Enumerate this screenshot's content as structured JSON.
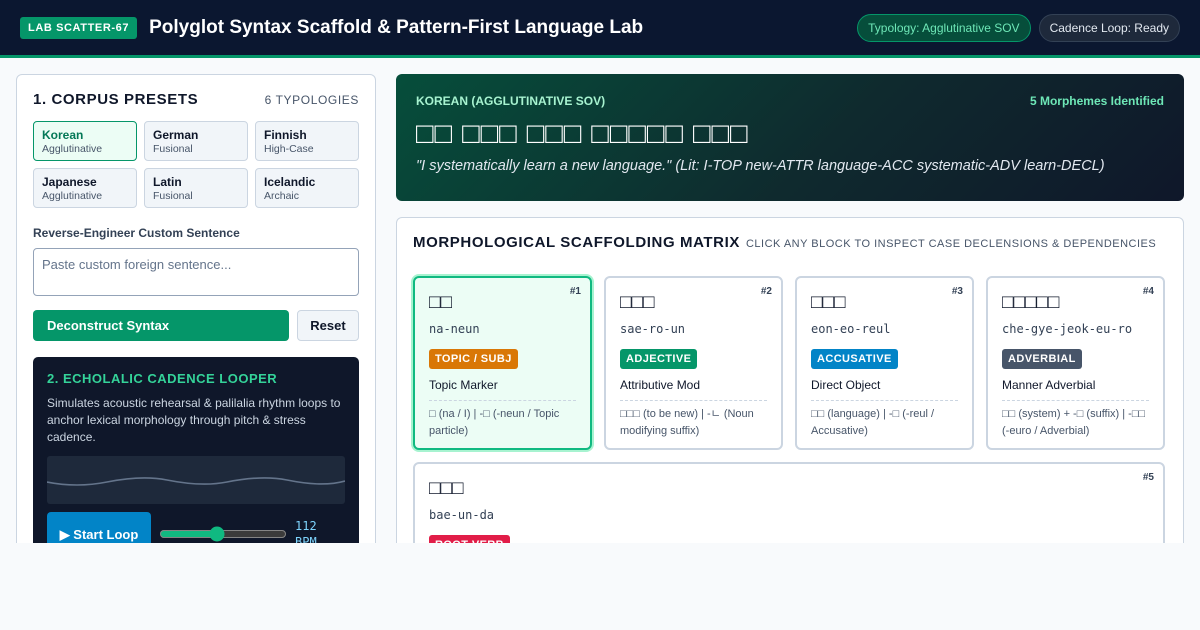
{
  "header": {
    "badge": "LAB SCATTER-67",
    "title": "Polyglot Syntax Scaffold & Pattern-First Language Lab",
    "typology_pill": "Typology: Agglutinative SOV",
    "cadence_pill": "Cadence Loop: Ready"
  },
  "presets": {
    "title": "1. CORPUS PRESETS",
    "count": "6 TYPOLOGIES",
    "items": [
      {
        "name": "Korean",
        "sub": "Agglutinative"
      },
      {
        "name": "German",
        "sub": "Fusional"
      },
      {
        "name": "Finnish",
        "sub": "High-Case"
      },
      {
        "name": "Japanese",
        "sub": "Agglutinative"
      },
      {
        "name": "Latin",
        "sub": "Fusional"
      },
      {
        "name": "Icelandic",
        "sub": "Archaic"
      }
    ],
    "custom_label": "Reverse-Engineer Custom Sentence",
    "custom_placeholder": "Paste custom foreign sentence...",
    "deconstruct_label": "Deconstruct Syntax",
    "reset_label": "Reset"
  },
  "cadence": {
    "title": "2. ECHOLALIC CADENCE LOOPER",
    "description": "Simulates acoustic rehearsal & palilalia rhythm loops to anchor lexical morphology through pitch & stress cadence.",
    "start_label": "▶ Start Loop",
    "bpm_value": "112",
    "bpm_unit": "BPM",
    "slider_value": 0.45
  },
  "hero": {
    "language": "KOREAN (AGGLUTINATIVE SOV)",
    "morpheme_count": "5 Morphemes Identified",
    "sentence": "□□ □□□ □□□ □□□□□ □□□",
    "translation": "\"I systematically learn a new language.\" (Lit: I-TOP new-ATTR language-ACC systematic-ADV learn-DECL)"
  },
  "matrix": {
    "title": "MORPHOLOGICAL SCAFFOLDING MATRIX",
    "hint": "CLICK ANY BLOCK TO INSPECT CASE DECLENSIONS & DEPENDENCIES",
    "blocks": [
      {
        "num": "#1",
        "script": "□□",
        "roman": "na-neun",
        "tag": "TOPIC / SUBJ",
        "color": "#d97706",
        "role": "Topic Marker",
        "gloss": "□ (na / I) | -□ (-neun / Topic particle)"
      },
      {
        "num": "#2",
        "script": "□□□",
        "roman": "sae-ro-un",
        "tag": "ADJECTIVE",
        "color": "#059669",
        "role": "Attributive Mod",
        "gloss": "□□□ (to be new) | -ㄴ (Noun modifying suffix)"
      },
      {
        "num": "#3",
        "script": "□□□",
        "roman": "eon-eo-reul",
        "tag": "ACCUSATIVE",
        "color": "#0284c7",
        "role": "Direct Object",
        "gloss": "□□ (language) | -□ (-reul / Accusative)"
      },
      {
        "num": "#4",
        "script": "□□□□□",
        "roman": "che-gye-jeok-eu-ro",
        "tag": "ADVERBIAL",
        "color": "#475569",
        "role": "Manner Adverbial",
        "gloss": "□□ (system) + -□ (suffix) | -□□ (-euro / Adverbial)"
      },
      {
        "num": "#5",
        "script": "□□□",
        "roman": "bae-un-da",
        "tag": "ROOT VERB",
        "color": "#e11d48",
        "role": "",
        "gloss": ""
      }
    ]
  }
}
